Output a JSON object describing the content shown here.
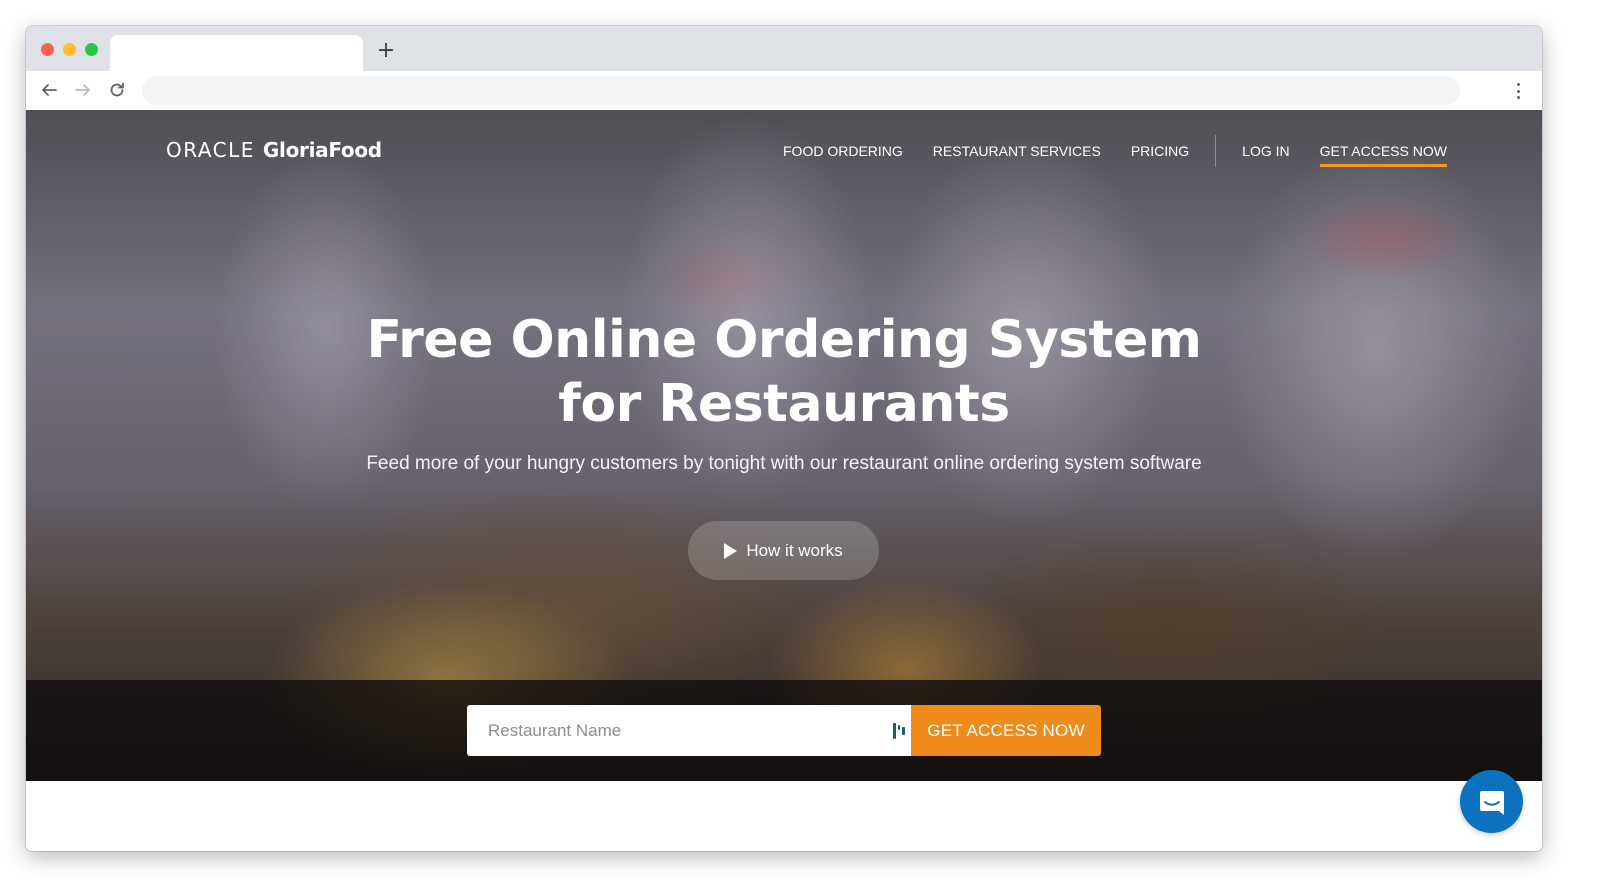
{
  "browser": {
    "tab_title": "",
    "new_tab_label": "+",
    "address": "",
    "icons": {
      "back": "arrow-left-icon",
      "forward": "arrow-right-icon",
      "reload": "reload-icon",
      "menu": "kebab-menu-icon"
    }
  },
  "site": {
    "logo": {
      "brand": "ORACLE",
      "product": "GloriaFood"
    },
    "nav": {
      "items": [
        {
          "label": "FOOD ORDERING"
        },
        {
          "label": "RESTAURANT SERVICES"
        },
        {
          "label": "PRICING"
        }
      ],
      "login": "LOG IN",
      "cta": "GET ACCESS NOW"
    },
    "hero": {
      "headline_line1": "Free Online Ordering System",
      "headline_line2": "for Restaurants",
      "subheadline": "Feed more of your hungry customers by tonight with our restaurant online ordering system software",
      "how_it_works": "How it works"
    },
    "signup": {
      "input_value": "",
      "input_placeholder": "Restaurant Name",
      "button_label": "GET ACCESS NOW"
    },
    "chat": {
      "icon": "chat-bubble-icon"
    }
  },
  "colors": {
    "accent_orange": "#ef8b1d",
    "chat_blue": "#0c71be",
    "nav_underline": "#f39a1e"
  }
}
